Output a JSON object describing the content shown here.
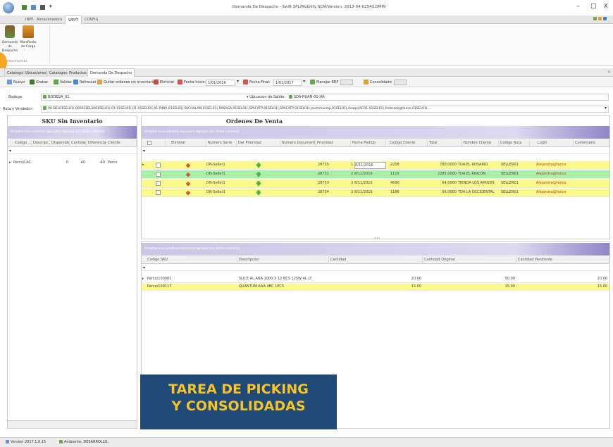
{
  "colors": {
    "row_yellow": "#fafa8c",
    "row_green": "#a8f0a8",
    "accent_orange": "#f5a623",
    "overlay_blue": "#1f4a78",
    "overlay_text": "#f7c325"
  },
  "titlebar": {
    "title": "Demanda De Despacho - Swift SPL/Mobility SCM/Version: 2012-04-0254/LDMIN",
    "min": "–",
    "max": "□",
    "close": "X"
  },
  "ribbon": {
    "tabs": [
      "INPE",
      "Almacenadora",
      "WEPT",
      "CONFIG"
    ],
    "buttons": [
      {
        "label": "Demanda de Despacho",
        "icon": "person-dispatch-icon"
      },
      {
        "label": "Manifiesto de Carga",
        "icon": "cargo-box-icon"
      }
    ],
    "group_label": "Movimientos"
  },
  "doc_tabs": [
    "Catalogo: Ubicaciones",
    "Catalogos: Productos",
    "Demanda De Despacho"
  ],
  "toolbar": {
    "nuevo": "Nuevo",
    "grabar": "Grabar",
    "validar": "Validar",
    "refrescar": "Refrescar",
    "quitar": "Quitar ordenes sin inventario",
    "eliminar": "Eliminar",
    "fecha_inicio_label": "Fecha Inicio:",
    "fecha_inicio": "1/01/2016",
    "fecha_final_label": "Fecha Final:",
    "fecha_final": "1/01/2017",
    "manejar": "Manejar ERP",
    "consolidado": "Consolidado"
  },
  "filters": {
    "bodega_label": "Bodega:",
    "bodega": "BODEGA_01",
    "ubicacion_label": "Ubicacion de Salida:",
    "ubicacion": "SDA-RUAN-01-HA",
    "ruta_label": "Ruta y Vendedor:",
    "ruta": "00-DEL01SEL01(,00001SEL2001SEL01(,01-01SEL01(,01-01SEL01(,01-P48A,01SEL01(,PACHALAM,01SEL01(,RASAGA,01SEL01(,SPACATP,01SEL01(,SPACATP,01SEL01(,parmmacmp,01SEL01(,Avaqn(ACO1,01SEL01(,federado@fanco,01SEL01(,..."
  },
  "left_panel": {
    "title": "SKU Sin Inventario",
    "group_hint": "Arrastre una columna aqui para agrupar por dicha columna",
    "columns": [
      "Codigo ...",
      "Descripc...",
      "Disponible",
      "Cantidad",
      "Diferencia",
      "Cliente"
    ],
    "rows": [
      [
        "Parco/LAC...",
        "",
        "0",
        "40",
        "-40",
        "Parco"
      ]
    ]
  },
  "orders": {
    "title": "Ordenes De Venta",
    "group_hint": "Arrastre una columna aqui para agrupar por dicha columna",
    "columns": [
      "",
      "Eliminar",
      "Numero Serie",
      "Dar Prioridad",
      "Numero Documento",
      "Prioridad",
      "Fecha Pedido",
      "Codigo Cliente",
      "Total",
      "Nombre Cliente",
      "Codigo Ruta",
      "Login",
      "Comentario"
    ],
    "rows": [
      {
        "serie": "DN-Seller1",
        "doc": "28735",
        "prio": "1",
        "fecha": "8/11/2016",
        "cliente": "2208",
        "total": "780.0000",
        "nombre": "TDA EL ROSARIO",
        "ruta": "SELLER01",
        "login": "Alejandra@fanco",
        "color": "yellow"
      },
      {
        "serie": "DN-Seller1",
        "doc": "28731",
        "prio": "2",
        "fecha": "8/11/2016",
        "cliente": "1115",
        "total": "2285.0000",
        "nombre": "TDA EL RINCON",
        "ruta": "SELLER01",
        "login": "Alejandra@fanco",
        "color": "green"
      },
      {
        "serie": "DN-Seller1",
        "doc": "28733",
        "prio": "3",
        "fecha": "8/11/2016",
        "cliente": "4690",
        "total": "64.0000",
        "nombre": "TIENDA LOS AMIGOS",
        "ruta": "SELLER01",
        "login": "Alejandra@fanco",
        "color": "yellow"
      },
      {
        "serie": "DN-Seller1",
        "doc": "28734",
        "prio": "3",
        "fecha": "8/11/2016",
        "cliente": "1186",
        "total": "56.0000",
        "nombre": "TDA LA OCCIDENTAL",
        "ruta": "SELLER01",
        "login": "Alejandra@fanco",
        "color": "yellow"
      }
    ]
  },
  "detail": {
    "group_hint": "Arrastre una columna aqui para agrupar por dicha columna",
    "columns": [
      "Codigo SKU",
      "Descripcion",
      "Cantidad",
      "Cantidad Original",
      "Cantidad Pendiente"
    ],
    "rows": [
      {
        "sku": "Parco/100081",
        "desc": "SLICE AL ANA 1000 X 12 BCS 12SW AL.LT",
        "cant": "20.00",
        "orig": "50.00",
        "pend": "20.00",
        "color": "white"
      },
      {
        "sku": "Parco/100117",
        "desc": "QUANTUM AAA 4BC 1PCS",
        "cant": "15.00",
        "orig": "15.00",
        "pend": "15.00",
        "color": "yellow"
      }
    ]
  },
  "overlay": {
    "line1": "TAREA DE PICKING",
    "line2": "Y CONSOLIDADAS"
  },
  "status": {
    "version": "Version 2017.1.0.15",
    "ambiente": "Ambiente: DESARROLLO",
    "extra": "..."
  }
}
